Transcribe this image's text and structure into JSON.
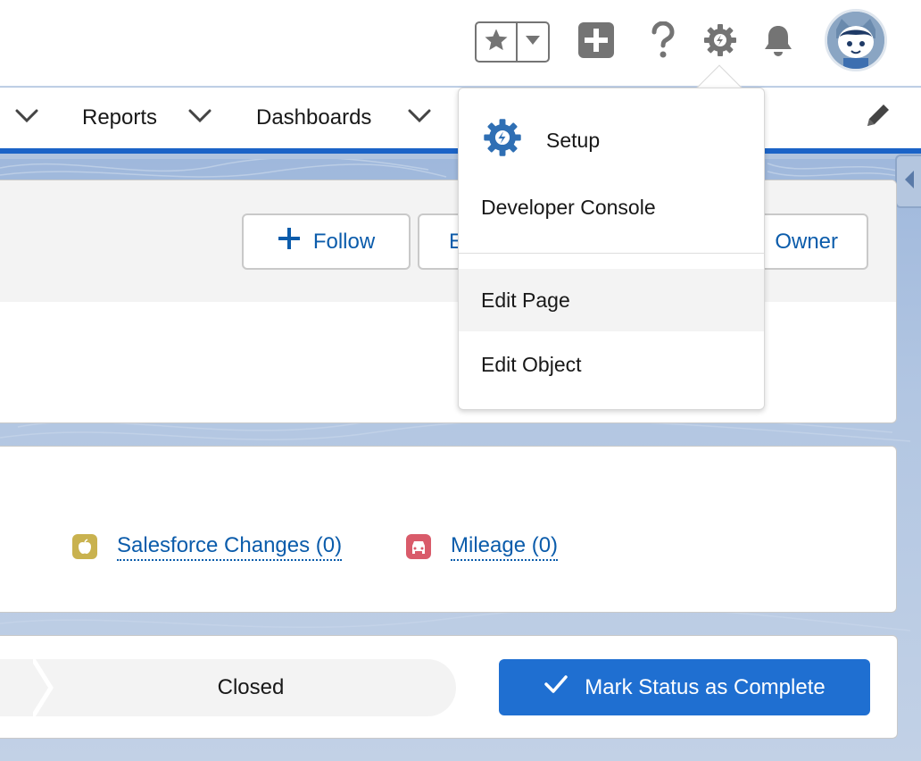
{
  "header": {
    "favorites_star_icon": "star-icon",
    "favorites_dropdown_icon": "caret-down-icon",
    "global_actions_icon": "plus-square-icon",
    "help_icon": "question-icon",
    "setup_icon": "gear-icon",
    "notifications_icon": "bell-icon",
    "avatar_icon": "astro-avatar"
  },
  "nav": {
    "items": [
      {
        "label": ""
      },
      {
        "label": "Reports"
      },
      {
        "label": "Dashboards"
      }
    ],
    "edit_icon": "pencil-icon"
  },
  "record_header": {
    "follow_label": "Follow",
    "edit_label_partial": "E",
    "owner_label_partial": "Owner"
  },
  "related_list": {
    "items": [
      {
        "label": "Salesforce Changes (0)",
        "icon": "apple-icon",
        "color": "#c9b24f"
      },
      {
        "label": "Mileage (0)",
        "icon": "car-icon",
        "color": "#d95b6a"
      }
    ]
  },
  "path": {
    "current_stage": "Closed",
    "mark_complete_label": "Mark Status as Complete"
  },
  "setup_menu": {
    "items": [
      {
        "label": "Setup",
        "icon": "setup-gear-icon"
      },
      {
        "label": "Developer Console"
      },
      {
        "label": "Edit Page"
      },
      {
        "label": "Edit Object"
      }
    ]
  },
  "colors": {
    "brand_blue": "#1b63c7",
    "link_blue": "#0b5cab",
    "button_blue": "#1f6fd1"
  }
}
